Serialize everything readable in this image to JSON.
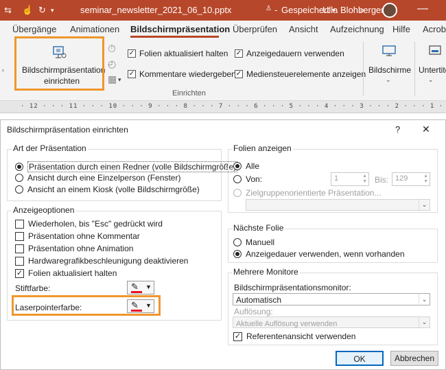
{
  "title_bar": {
    "filename": "seminar_newsletter_2021_06_10.pptx",
    "save_state": "Gespeichert",
    "user_name": "Ulla Blohberger"
  },
  "ribbon_tabs": [
    "Übergänge",
    "Animationen",
    "Bildschirmpräsentation",
    "Überprüfen",
    "Ansicht",
    "Aufzeichnung",
    "Hilfe",
    "Acrob"
  ],
  "ribbon": {
    "setup_button_line1": "Bildschirmpräsentation",
    "setup_button_line2": "einrichten",
    "checkboxes": [
      {
        "label": "Folien aktualisiert halten",
        "checked": true
      },
      {
        "label": "Kommentare wiedergeben",
        "checked": true
      },
      {
        "label": "Anzeigedauern verwenden",
        "checked": true
      },
      {
        "label": "Mediensteuerelemente anzeigen",
        "checked": true
      }
    ],
    "group_label": "Einrichten",
    "monitors_label": "Bildschirme",
    "subtitles_label": "Untertite"
  },
  "ruler_numbers": "· 12 · · · 11 · · · 10 · · · 9 · · · 8 · · · 7 · · · 6 · · · 5 · · · 4 · · · 3 · · · 2 · · · 1 · · · 0 · · · 1 · · · 2 · · · 3 · · · 4 · · · 5 · · · 6 · · · 7",
  "dialog": {
    "title": "Bildschirmpräsentation einrichten",
    "help": "?",
    "close": "✕",
    "presentation_type": {
      "title": "Art der Präsentation",
      "options": [
        {
          "label": "Präsentation durch einen Redner (volle Bildschirmgröße)",
          "selected": true
        },
        {
          "label": "Ansicht durch eine Einzelperson (Fenster)",
          "selected": false
        },
        {
          "label": "Ansicht an einem Kiosk (volle Bildschirmgröße)",
          "selected": false
        }
      ]
    },
    "display_options": {
      "title": "Anzeigeoptionen",
      "checkboxes": [
        {
          "label": "Wiederholen, bis \"Esc\" gedrückt wird",
          "checked": false
        },
        {
          "label": "Präsentation ohne Kommentar",
          "checked": false
        },
        {
          "label": "Präsentation ohne Animation",
          "checked": false
        },
        {
          "label": "Hardwaregrafikbeschleunigung deaktivieren",
          "checked": false
        },
        {
          "label": "Folien aktualisiert halten",
          "checked": true
        }
      ],
      "pen_color_label": "Stiftfarbe:",
      "laser_color_label": "Laserpointerfarbe:"
    },
    "show_slides": {
      "title": "Folien anzeigen",
      "all_label": "Alle",
      "from_label": "Von:",
      "from_value": "1",
      "to_label": "Bis:",
      "to_value": "129",
      "custom_label": "Zielgruppenorientierte Präsentation..."
    },
    "next_slide": {
      "title": "Nächste Folie",
      "manual_label": "Manuell",
      "timing_label": "Anzeigedauer verwenden, wenn vorhanden"
    },
    "multiple_monitors": {
      "title": "Mehrere Monitore",
      "monitor_label": "Bildschirmpräsentationsmonitor:",
      "monitor_value": "Automatisch",
      "resolution_label": "Auflösung:",
      "resolution_value": "Aktuelle Auflösung verwenden",
      "presenter_view_label": "Referentenansicht verwenden",
      "presenter_view_checked": true
    },
    "ok_label": "OK",
    "cancel_label": "Abbrechen"
  },
  "colors": {
    "title_bar": "#b7472a",
    "highlight": "#f0962d",
    "pen_color": "#e81123"
  }
}
